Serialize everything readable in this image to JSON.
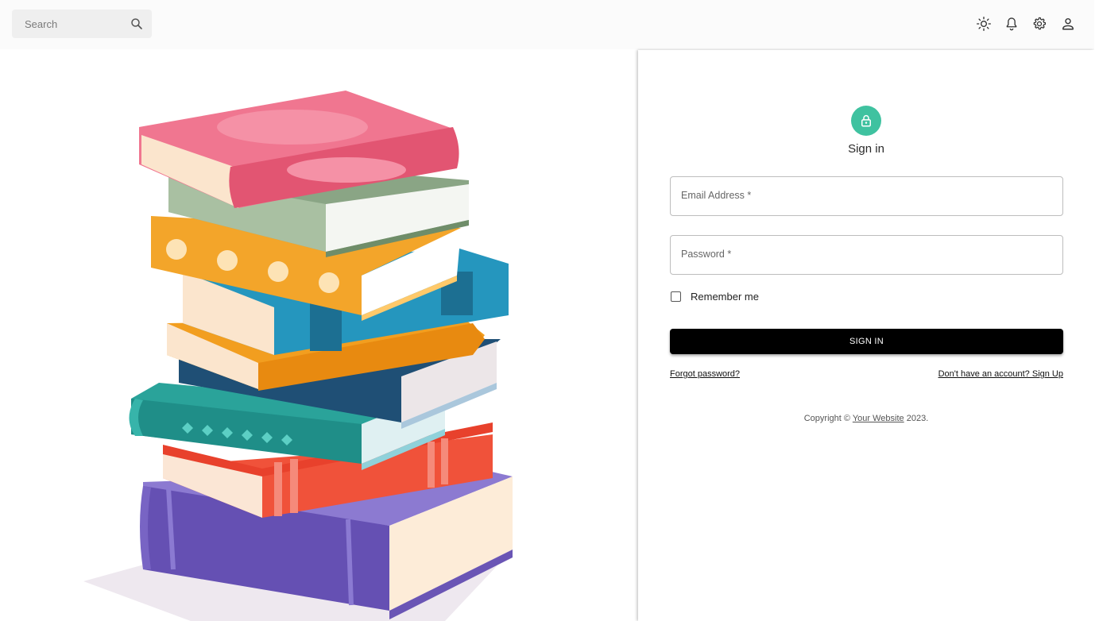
{
  "search": {
    "placeholder": "Search",
    "icon": "search-icon"
  },
  "topbar": {
    "icons": [
      "sun-icon",
      "bell-icon",
      "gear-icon",
      "person-icon"
    ]
  },
  "colors": {
    "accent": "#3fc2a0",
    "button": "#000000",
    "book_pink": "#e8566f",
    "book_sage": "#8aa585",
    "book_orange": "#f3a52a",
    "book_blue": "#2596be",
    "book_teal": "#2aa39a",
    "book_red": "#f0523a",
    "book_purple": "#6b55b5"
  },
  "signin": {
    "icon": "lock-icon",
    "title": "Sign in",
    "email_label": "Email Address *",
    "password_label": "Password *",
    "remember_label": "Remember me",
    "button_label": "SIGN IN",
    "forgot_link": "Forgot password?",
    "signup_link": "Don't have an account? Sign Up",
    "copyright_prefix": "Copyright © ",
    "copyright_site": "Your Website",
    "copyright_suffix": " 2023."
  }
}
